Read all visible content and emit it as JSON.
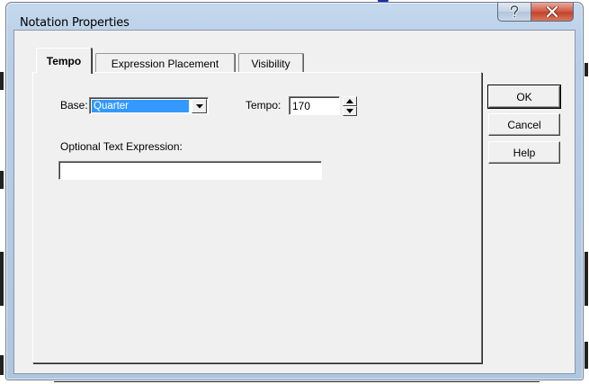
{
  "window": {
    "title": "Notation Properties",
    "help_button_label": "?",
    "close_button_label": "×"
  },
  "tabs": [
    {
      "label": "Tempo",
      "active": true
    },
    {
      "label": "Expression Placement",
      "active": false
    },
    {
      "label": "Visibility",
      "active": false
    }
  ],
  "tempo_tab": {
    "base_label": "Base:",
    "base_value": "Quarter",
    "tempo_label": "Tempo:",
    "tempo_value": "170",
    "expression_label": "Optional Text Expression:",
    "expression_value": ""
  },
  "buttons": {
    "ok_label": "OK",
    "cancel_label": "Cancel",
    "help_label": "Help"
  },
  "icons": {
    "combo_arrow": "chevron-down-icon",
    "spin_up": "triangle-up-icon",
    "spin_down": "triangle-down-icon",
    "help": "question-icon",
    "close": "close-icon"
  },
  "colors": {
    "selection": "#3399ff",
    "close_button": "#c9472f",
    "dialog_face": "#f0f0f0",
    "frame": "#b8cfe7"
  }
}
